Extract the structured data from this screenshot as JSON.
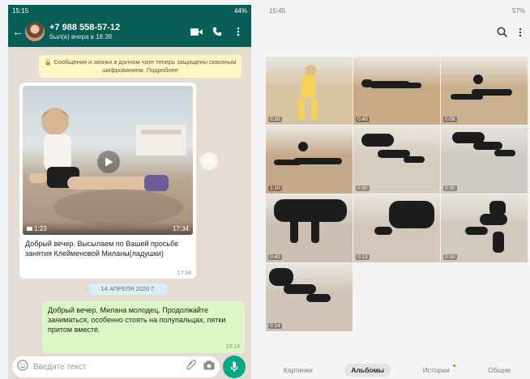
{
  "chat": {
    "status_time": "15:15",
    "status_battery": "44%",
    "contact_number": "+7 988 558-57-12",
    "last_seen": "был(а) вчера в 18:38",
    "encryption_notice": "🔒 Сообщения и звонки в данном чате теперь защищены сквозным шифрованием. Подробнее",
    "video_duration": "1:23",
    "video_time": "17:34",
    "incoming_text": "Добрый вечер. Высылаем по Вашей просьбе занятия Клейменовой Миланы(ладушки)",
    "incoming_time": "17:34",
    "date_chip": "14 АПРЕЛЯ 2020 Г.",
    "outgoing_text": "Добрый вечер, Милана молодец. Продолжайте заниматься, особенно стоять на полупальцах, пятки притом вместе.",
    "outgoing_time": "19:14",
    "input_placeholder": "Введите текст"
  },
  "gallery": {
    "status_time": "15:45",
    "status_battery": "57%",
    "tiles": [
      {
        "label": "0:10",
        "bg": "#d8c3a2",
        "accent": "#f2d25a"
      },
      {
        "label": "0:40",
        "bg": "#c8ab86",
        "accent": "#1d1d1d"
      },
      {
        "label": "0:08",
        "bg": "#c9b08e",
        "accent": "#1d1d1d"
      },
      {
        "label": "1:10",
        "bg": "#c5a98a",
        "accent": "#1d1d1d"
      },
      {
        "label": "0:30",
        "bg": "#d6ccc0",
        "accent": "#1d1d1d"
      },
      {
        "label": "0:30",
        "bg": "#cfcac4",
        "accent": "#1d1d1d"
      },
      {
        "label": "0:40",
        "bg": "#cbbfb2",
        "accent": "#1d1d1d"
      },
      {
        "label": "0:13",
        "bg": "#d3c7ba",
        "accent": "#1d1d1d"
      },
      {
        "label": "0:10",
        "bg": "#d2c8bd",
        "accent": "#1d1d1d"
      },
      {
        "label": "0:14",
        "bg": "#cfc4b6",
        "accent": "#1d1d1d"
      }
    ],
    "tabs": [
      "Картинки",
      "Альбомы",
      "Истории",
      "Общие"
    ]
  },
  "colors": {
    "header_green": "#075e54",
    "outgoing_bubble": "#dcf8c6",
    "mic_green": "#00a884"
  }
}
